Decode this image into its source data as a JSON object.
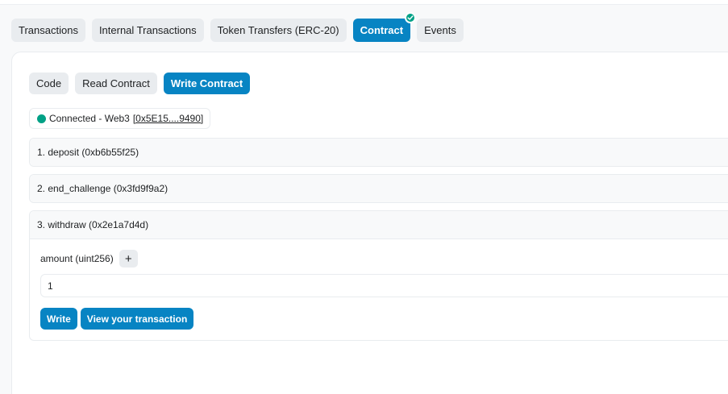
{
  "tabs": [
    {
      "label": "Transactions",
      "active": false
    },
    {
      "label": "Internal Transactions",
      "active": false
    },
    {
      "label": "Token Transfers (ERC-20)",
      "active": false
    },
    {
      "label": "Contract",
      "active": true,
      "verified": true
    },
    {
      "label": "Events",
      "active": false
    }
  ],
  "subtabs": [
    {
      "label": "Code",
      "active": false
    },
    {
      "label": "Read Contract",
      "active": false
    },
    {
      "label": "Write Contract",
      "active": true
    }
  ],
  "connection": {
    "text": "Connected - Web3",
    "address": "[0x5E15....9490]",
    "status_color": "#00a186"
  },
  "functions": [
    {
      "label": "1. deposit (0xb6b55f25)",
      "expanded": false
    },
    {
      "label": "2. end_challenge (0x3fd9f9a2)",
      "expanded": false
    },
    {
      "label": "3. withdraw (0x2e1a7d4d)",
      "expanded": true,
      "param_label": "amount (uint256)",
      "param_value": "1",
      "write_label": "Write",
      "view_label": "View your transaction"
    }
  ],
  "colors": {
    "primary": "#0784c3",
    "success": "#00a186"
  }
}
